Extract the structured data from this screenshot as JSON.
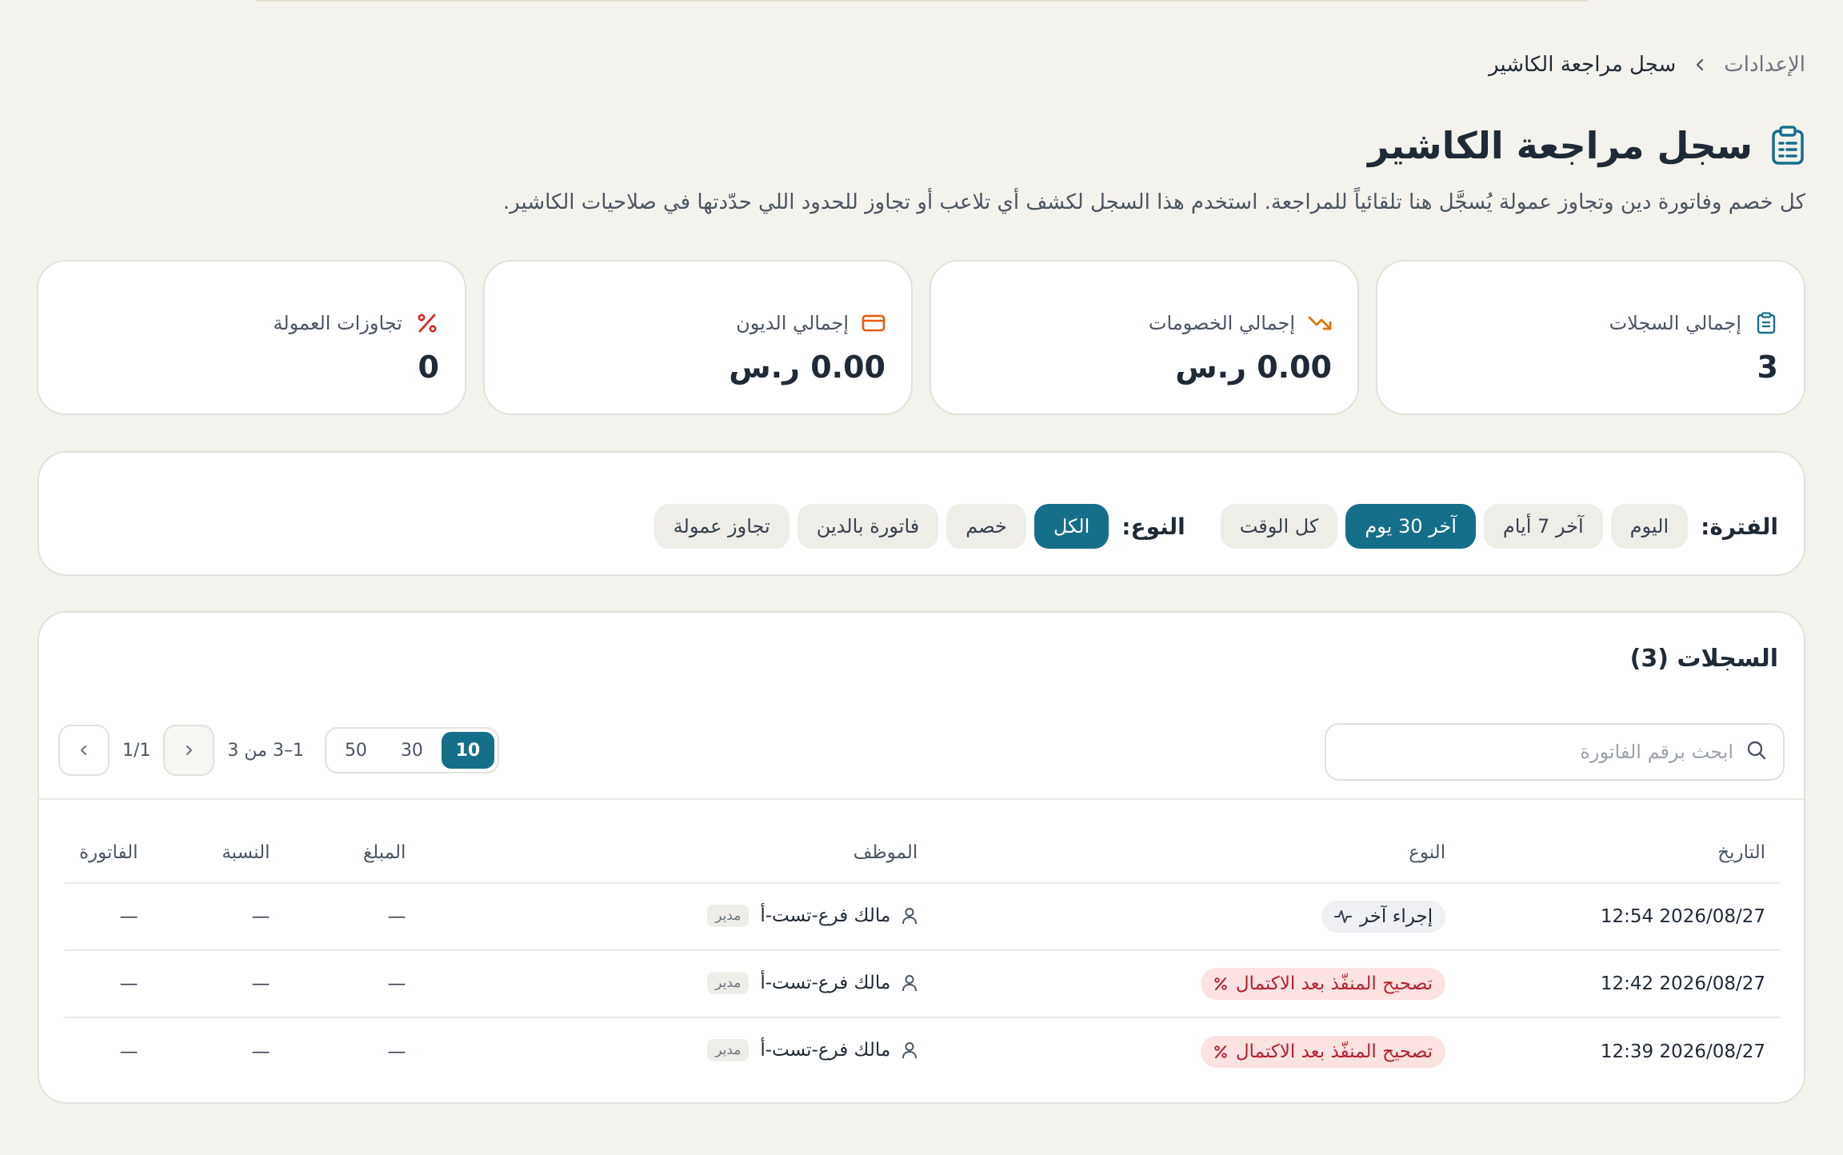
{
  "breadcrumb": {
    "parent": "الإعدادات",
    "current": "سجل مراجعة الكاشير"
  },
  "header": {
    "title": "سجل مراجعة الكاشير",
    "subtitle": "كل خصم وفاتورة دين وتجاوز عمولة يُسجَّل هنا تلقائياً للمراجعة. استخدم هذا السجل لكشف أي تلاعب أو تجاوز للحدود اللي حدّدتها في صلاحيات الكاشير."
  },
  "stats": [
    {
      "label": "إجمالي السجلات",
      "value": "3",
      "icon": "clipboard-icon",
      "color": "#156f8a"
    },
    {
      "label": "إجمالي الخصومات",
      "value": "0.00 ر.س",
      "icon": "trending-down-icon",
      "color": "#d97706"
    },
    {
      "label": "إجمالي الديون",
      "value": "0.00 ر.س",
      "icon": "credit-card-icon",
      "color": "#ea580c"
    },
    {
      "label": "تجاوزات العمولة",
      "value": "0",
      "icon": "percent-icon",
      "color": "#dc2626"
    }
  ],
  "filters": {
    "period_label": "الفترة:",
    "period_options": [
      "اليوم",
      "آخر 7 أيام",
      "آخر 30 يوم",
      "كل الوقت"
    ],
    "period_selected": "آخر 30 يوم",
    "type_label": "النوع:",
    "type_options": [
      "الكل",
      "خصم",
      "فاتورة بالدين",
      "تجاوز عمولة"
    ],
    "type_selected": "الكل"
  },
  "records": {
    "title": "السجلات (3)",
    "search_placeholder": "ابحث برقم الفاتورة",
    "page_sizes": [
      "10",
      "30",
      "50"
    ],
    "page_size_selected": "10",
    "range_text": "1–3 من 3",
    "page_text": "1/1",
    "columns": [
      "التاريخ",
      "النوع",
      "الموظف",
      "المبلغ",
      "النسبة",
      "الفاتورة"
    ],
    "rows": [
      {
        "date": "2026/08/27 12:54",
        "type": "إجراء آخر",
        "type_kind": "other",
        "employee": "مالك فرع-تست-أ",
        "role": "مدير",
        "amount": "—",
        "percent": "—",
        "invoice": "—"
      },
      {
        "date": "2026/08/27 12:42",
        "type": "تصحيح المنفّذ بعد الاكتمال",
        "type_kind": "fix",
        "employee": "مالك فرع-تست-أ",
        "role": "مدير",
        "amount": "—",
        "percent": "—",
        "invoice": "—"
      },
      {
        "date": "2026/08/27 12:39",
        "type": "تصحيح المنفّذ بعد الاكتمال",
        "type_kind": "fix",
        "employee": "مالك فرع-تست-أ",
        "role": "مدير",
        "amount": "—",
        "percent": "—",
        "invoice": "—"
      }
    ]
  },
  "colors": {
    "accent": "#156f8a",
    "background": "#f4f2ec",
    "danger_bg": "#fde2e2",
    "danger_text": "#b4232f"
  }
}
